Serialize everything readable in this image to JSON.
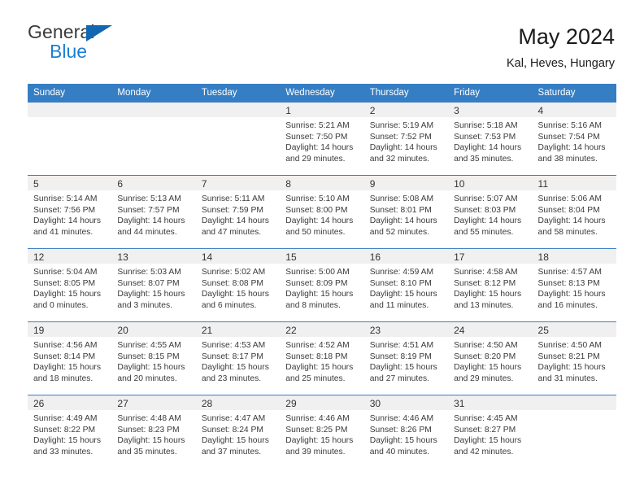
{
  "brand": {
    "name_part1": "General",
    "name_part2": "Blue",
    "triangle_color": "#1267b3",
    "blue_color": "#1b7fd4"
  },
  "header": {
    "title": "May 2024",
    "subtitle": "Kal, Heves, Hungary"
  },
  "theme": {
    "header_row_bg": "#357ec4",
    "header_row_text": "#ffffff",
    "daynum_bg": "#f0f0f0",
    "row_divider": "#3f7fc2"
  },
  "weekday_headers": [
    "Sunday",
    "Monday",
    "Tuesday",
    "Wednesday",
    "Thursday",
    "Friday",
    "Saturday"
  ],
  "labels": {
    "sunrise_prefix": "Sunrise:",
    "sunset_prefix": "Sunset:",
    "daylight_prefix": "Daylight:"
  },
  "weeks": [
    [
      {
        "day": "",
        "empty": true,
        "l1": "",
        "l2": "",
        "l3": "",
        "l4": ""
      },
      {
        "day": "",
        "empty": true,
        "l1": "",
        "l2": "",
        "l3": "",
        "l4": ""
      },
      {
        "day": "",
        "empty": true,
        "l1": "",
        "l2": "",
        "l3": "",
        "l4": ""
      },
      {
        "day": "1",
        "empty": false,
        "l1": "Sunrise: 5:21 AM",
        "l2": "Sunset: 7:50 PM",
        "l3": "Daylight: 14 hours",
        "l4": "and 29 minutes."
      },
      {
        "day": "2",
        "empty": false,
        "l1": "Sunrise: 5:19 AM",
        "l2": "Sunset: 7:52 PM",
        "l3": "Daylight: 14 hours",
        "l4": "and 32 minutes."
      },
      {
        "day": "3",
        "empty": false,
        "l1": "Sunrise: 5:18 AM",
        "l2": "Sunset: 7:53 PM",
        "l3": "Daylight: 14 hours",
        "l4": "and 35 minutes."
      },
      {
        "day": "4",
        "empty": false,
        "l1": "Sunrise: 5:16 AM",
        "l2": "Sunset: 7:54 PM",
        "l3": "Daylight: 14 hours",
        "l4": "and 38 minutes."
      }
    ],
    [
      {
        "day": "5",
        "empty": false,
        "l1": "Sunrise: 5:14 AM",
        "l2": "Sunset: 7:56 PM",
        "l3": "Daylight: 14 hours",
        "l4": "and 41 minutes."
      },
      {
        "day": "6",
        "empty": false,
        "l1": "Sunrise: 5:13 AM",
        "l2": "Sunset: 7:57 PM",
        "l3": "Daylight: 14 hours",
        "l4": "and 44 minutes."
      },
      {
        "day": "7",
        "empty": false,
        "l1": "Sunrise: 5:11 AM",
        "l2": "Sunset: 7:59 PM",
        "l3": "Daylight: 14 hours",
        "l4": "and 47 minutes."
      },
      {
        "day": "8",
        "empty": false,
        "l1": "Sunrise: 5:10 AM",
        "l2": "Sunset: 8:00 PM",
        "l3": "Daylight: 14 hours",
        "l4": "and 50 minutes."
      },
      {
        "day": "9",
        "empty": false,
        "l1": "Sunrise: 5:08 AM",
        "l2": "Sunset: 8:01 PM",
        "l3": "Daylight: 14 hours",
        "l4": "and 52 minutes."
      },
      {
        "day": "10",
        "empty": false,
        "l1": "Sunrise: 5:07 AM",
        "l2": "Sunset: 8:03 PM",
        "l3": "Daylight: 14 hours",
        "l4": "and 55 minutes."
      },
      {
        "day": "11",
        "empty": false,
        "l1": "Sunrise: 5:06 AM",
        "l2": "Sunset: 8:04 PM",
        "l3": "Daylight: 14 hours",
        "l4": "and 58 minutes."
      }
    ],
    [
      {
        "day": "12",
        "empty": false,
        "l1": "Sunrise: 5:04 AM",
        "l2": "Sunset: 8:05 PM",
        "l3": "Daylight: 15 hours",
        "l4": "and 0 minutes."
      },
      {
        "day": "13",
        "empty": false,
        "l1": "Sunrise: 5:03 AM",
        "l2": "Sunset: 8:07 PM",
        "l3": "Daylight: 15 hours",
        "l4": "and 3 minutes."
      },
      {
        "day": "14",
        "empty": false,
        "l1": "Sunrise: 5:02 AM",
        "l2": "Sunset: 8:08 PM",
        "l3": "Daylight: 15 hours",
        "l4": "and 6 minutes."
      },
      {
        "day": "15",
        "empty": false,
        "l1": "Sunrise: 5:00 AM",
        "l2": "Sunset: 8:09 PM",
        "l3": "Daylight: 15 hours",
        "l4": "and 8 minutes."
      },
      {
        "day": "16",
        "empty": false,
        "l1": "Sunrise: 4:59 AM",
        "l2": "Sunset: 8:10 PM",
        "l3": "Daylight: 15 hours",
        "l4": "and 11 minutes."
      },
      {
        "day": "17",
        "empty": false,
        "l1": "Sunrise: 4:58 AM",
        "l2": "Sunset: 8:12 PM",
        "l3": "Daylight: 15 hours",
        "l4": "and 13 minutes."
      },
      {
        "day": "18",
        "empty": false,
        "l1": "Sunrise: 4:57 AM",
        "l2": "Sunset: 8:13 PM",
        "l3": "Daylight: 15 hours",
        "l4": "and 16 minutes."
      }
    ],
    [
      {
        "day": "19",
        "empty": false,
        "l1": "Sunrise: 4:56 AM",
        "l2": "Sunset: 8:14 PM",
        "l3": "Daylight: 15 hours",
        "l4": "and 18 minutes."
      },
      {
        "day": "20",
        "empty": false,
        "l1": "Sunrise: 4:55 AM",
        "l2": "Sunset: 8:15 PM",
        "l3": "Daylight: 15 hours",
        "l4": "and 20 minutes."
      },
      {
        "day": "21",
        "empty": false,
        "l1": "Sunrise: 4:53 AM",
        "l2": "Sunset: 8:17 PM",
        "l3": "Daylight: 15 hours",
        "l4": "and 23 minutes."
      },
      {
        "day": "22",
        "empty": false,
        "l1": "Sunrise: 4:52 AM",
        "l2": "Sunset: 8:18 PM",
        "l3": "Daylight: 15 hours",
        "l4": "and 25 minutes."
      },
      {
        "day": "23",
        "empty": false,
        "l1": "Sunrise: 4:51 AM",
        "l2": "Sunset: 8:19 PM",
        "l3": "Daylight: 15 hours",
        "l4": "and 27 minutes."
      },
      {
        "day": "24",
        "empty": false,
        "l1": "Sunrise: 4:50 AM",
        "l2": "Sunset: 8:20 PM",
        "l3": "Daylight: 15 hours",
        "l4": "and 29 minutes."
      },
      {
        "day": "25",
        "empty": false,
        "l1": "Sunrise: 4:50 AM",
        "l2": "Sunset: 8:21 PM",
        "l3": "Daylight: 15 hours",
        "l4": "and 31 minutes."
      }
    ],
    [
      {
        "day": "26",
        "empty": false,
        "l1": "Sunrise: 4:49 AM",
        "l2": "Sunset: 8:22 PM",
        "l3": "Daylight: 15 hours",
        "l4": "and 33 minutes."
      },
      {
        "day": "27",
        "empty": false,
        "l1": "Sunrise: 4:48 AM",
        "l2": "Sunset: 8:23 PM",
        "l3": "Daylight: 15 hours",
        "l4": "and 35 minutes."
      },
      {
        "day": "28",
        "empty": false,
        "l1": "Sunrise: 4:47 AM",
        "l2": "Sunset: 8:24 PM",
        "l3": "Daylight: 15 hours",
        "l4": "and 37 minutes."
      },
      {
        "day": "29",
        "empty": false,
        "l1": "Sunrise: 4:46 AM",
        "l2": "Sunset: 8:25 PM",
        "l3": "Daylight: 15 hours",
        "l4": "and 39 minutes."
      },
      {
        "day": "30",
        "empty": false,
        "l1": "Sunrise: 4:46 AM",
        "l2": "Sunset: 8:26 PM",
        "l3": "Daylight: 15 hours",
        "l4": "and 40 minutes."
      },
      {
        "day": "31",
        "empty": false,
        "l1": "Sunrise: 4:45 AM",
        "l2": "Sunset: 8:27 PM",
        "l3": "Daylight: 15 hours",
        "l4": "and 42 minutes."
      },
      {
        "day": "",
        "empty": true,
        "l1": "",
        "l2": "",
        "l3": "",
        "l4": ""
      }
    ]
  ]
}
